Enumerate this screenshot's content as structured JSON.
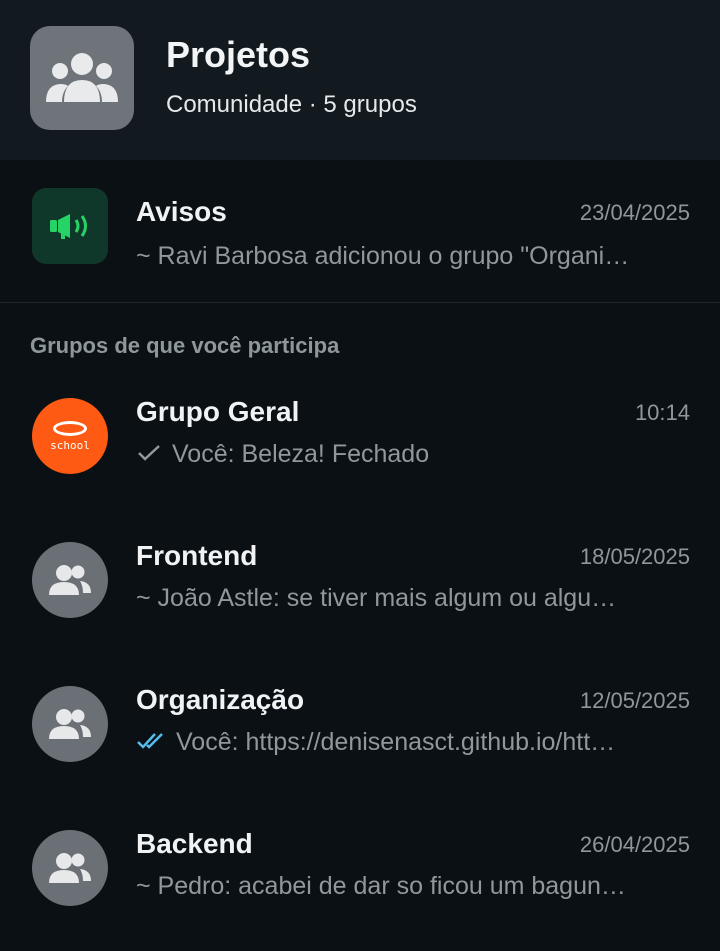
{
  "community": {
    "name": "Projetos",
    "subtitle": "Comunidade · 5 grupos",
    "avatar_icon": "community-group-icon"
  },
  "announcements": {
    "name": "Avisos",
    "time": "23/04/2025",
    "message": "~ Ravi Barbosa adicionou o grupo \"Organi…",
    "icon": "megaphone-icon",
    "icon_color": "#25d366"
  },
  "section_label": "Grupos de que você participa",
  "groups": [
    {
      "name": "Grupo Geral",
      "time": "10:14",
      "status": "sent",
      "message": "Você: Beleza! Fechado",
      "avatar": "school-logo",
      "avatar_text": "school"
    },
    {
      "name": "Frontend",
      "time": "18/05/2025",
      "status": "",
      "message": "~ João Astle: se tiver mais algum ou algu…",
      "avatar": "group-icon"
    },
    {
      "name": "Organização",
      "time": "12/05/2025",
      "status": "read",
      "message": "Você: https://denisenasct.github.io/htt…",
      "avatar": "group-icon"
    },
    {
      "name": "Backend",
      "time": "26/04/2025",
      "status": "",
      "message": "~ Pedro: acabei de dar so ficou um bagun…",
      "avatar": "group-icon"
    }
  ],
  "colors": {
    "background": "#0b1014",
    "header": "#121a1f",
    "read_tick": "#53bdeb",
    "school_orange": "#ff5a14"
  }
}
